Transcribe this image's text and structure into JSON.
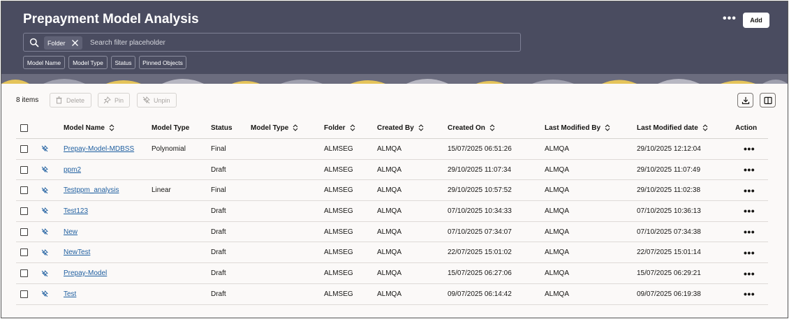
{
  "header": {
    "title": "Prepayment Model Analysis",
    "more_label": "•••",
    "add_label": "Add"
  },
  "search": {
    "chip_label": "Folder",
    "placeholder": "Search filter placeholder"
  },
  "filters": [
    "Model Name",
    "Model Type",
    "Status",
    "Pinned Objects"
  ],
  "toolbar": {
    "items_count": "8 items",
    "delete_label": "Delete",
    "pin_label": "Pin",
    "unpin_label": "Unpin"
  },
  "table": {
    "columns": {
      "model_name": "Model Name",
      "model_type": "Model Type",
      "status": "Status",
      "model_type_2": "Model Type",
      "folder": "Folder",
      "created_by": "Created By",
      "created_on": "Created On",
      "last_modified_by": "Last Modified By",
      "last_modified_date": "Last Modified date",
      "action": "Action"
    },
    "rows": [
      {
        "name": "Prepay-Model-MDBSS",
        "type": "Polynomial",
        "status": "Final",
        "folder": "ALMSEG",
        "created_by": "ALMQA",
        "created_on": "15/07/2025 06:51:26",
        "modified_by": "ALMQA",
        "modified_date": "29/10/2025 12:12:04",
        "action": "•••"
      },
      {
        "name": "ppm2",
        "type": "",
        "status": "Draft",
        "folder": "ALMSEG",
        "created_by": "ALMQA",
        "created_on": "29/10/2025 11:07:34",
        "modified_by": "ALMQA",
        "modified_date": "29/10/2025 11:07:49",
        "action": "•••"
      },
      {
        "name": "Testppm_analysis",
        "type": "Linear",
        "status": "Final",
        "folder": "ALMSEG",
        "created_by": "ALMQA",
        "created_on": "29/10/2025 10:57:52",
        "modified_by": "ALMQA",
        "modified_date": "29/10/2025 11:02:38",
        "action": "•••"
      },
      {
        "name": "Test123",
        "type": "",
        "status": "Draft",
        "folder": "ALMSEG",
        "created_by": "ALMQA",
        "created_on": "07/10/2025 10:34:33",
        "modified_by": "ALMQA",
        "modified_date": "07/10/2025 10:36:13",
        "action": "•••"
      },
      {
        "name": "New",
        "type": "",
        "status": "Draft",
        "folder": "ALMSEG",
        "created_by": "ALMQA",
        "created_on": "07/10/2025 07:34:07",
        "modified_by": "ALMQA",
        "modified_date": "07/10/2025 07:34:38",
        "action": "•••"
      },
      {
        "name": "NewTest",
        "type": "",
        "status": "Draft",
        "folder": "ALMSEG",
        "created_by": "ALMQA",
        "created_on": "22/07/2025 15:01:02",
        "modified_by": "ALMQA",
        "modified_date": "22/07/2025 15:01:14",
        "action": "•••"
      },
      {
        "name": "Prepay-Model",
        "type": "",
        "status": "Draft",
        "folder": "ALMSEG",
        "created_by": "ALMQA",
        "created_on": "15/07/2025 06:27:06",
        "modified_by": "ALMQA",
        "modified_date": "15/07/2025 06:29:21",
        "action": "•••"
      },
      {
        "name": "Test",
        "type": "",
        "status": "Draft",
        "folder": "ALMSEG",
        "created_by": "ALMQA",
        "created_on": "09/07/2025 06:14:42",
        "modified_by": "ALMQA",
        "modified_date": "09/07/2025 06:19:38",
        "action": "•••"
      }
    ]
  },
  "colors": {
    "header_bg": "#4a4c60",
    "link": "#1f5fa0",
    "page_bg": "#fbf9f8"
  }
}
